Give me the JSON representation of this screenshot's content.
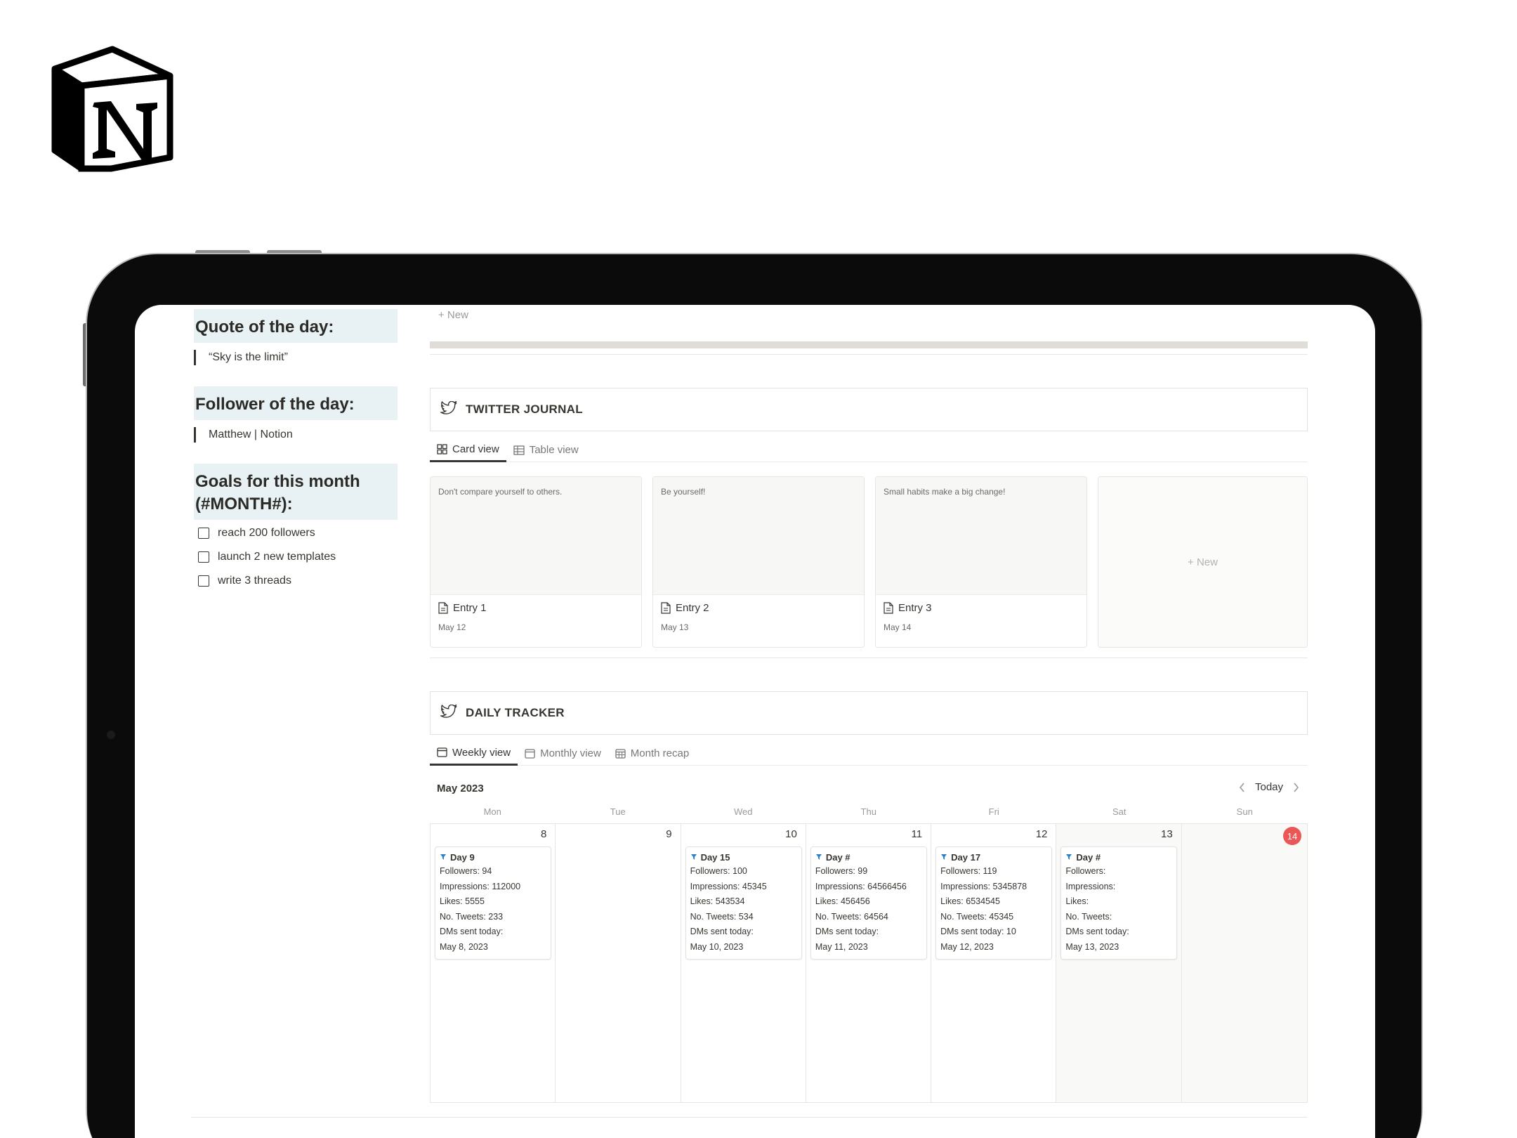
{
  "left": {
    "quote": {
      "heading": "Quote of the day:",
      "text": "“Sky is the limit”"
    },
    "follower": {
      "heading": "Follower of the day:",
      "text": "Matthew | Notion"
    },
    "goals": {
      "heading": "Goals for this month (#MONTH#):",
      "items": [
        "reach 200 followers",
        "launch 2 new templates",
        "write 3 threads"
      ]
    }
  },
  "top_new_label": "+ New",
  "twitter_journal": {
    "title": "TWITTER JOURNAL",
    "tabs": [
      "Card view",
      "Table view"
    ],
    "cards": [
      {
        "preview": "Don't compare yourself to others.",
        "title": "Entry 1",
        "date": "May 12"
      },
      {
        "preview": "Be yourself!",
        "title": "Entry 2",
        "date": "May 13"
      },
      {
        "preview": "Small habits make a big change!",
        "title": "Entry 3",
        "date": "May 14"
      }
    ],
    "new_label": "+ New"
  },
  "daily_tracker": {
    "title": "DAILY TRACKER",
    "tabs": [
      "Weekly view",
      "Monthly view",
      "Month recap"
    ],
    "month": "May 2023",
    "today_label": "Today",
    "weekdays": [
      "Mon",
      "Tue",
      "Wed",
      "Thu",
      "Fri",
      "Sat",
      "Sun"
    ],
    "days": [
      {
        "num": "8",
        "entry": {
          "title": "Day 9",
          "lines": [
            "Followers: 94",
            "Impressions: 112000",
            "Likes: 5555",
            "No. Tweets: 233",
            "DMs sent today:",
            "May 8, 2023"
          ]
        }
      },
      {
        "num": "9"
      },
      {
        "num": "10",
        "entry": {
          "title": "Day 15",
          "lines": [
            "Followers: 100",
            "Impressions: 45345",
            "Likes: 543534",
            "No. Tweets: 534",
            "DMs sent today:",
            "May 10, 2023"
          ]
        }
      },
      {
        "num": "11",
        "entry": {
          "title": "Day #",
          "lines": [
            "Followers: 99",
            "Impressions: 64566456",
            "Likes: 456456",
            "No. Tweets: 64564",
            "DMs sent today:",
            "May 11, 2023"
          ]
        }
      },
      {
        "num": "12",
        "entry": {
          "title": "Day 17",
          "lines": [
            "Followers: 119",
            "Impressions: 5345878",
            "Likes: 6534545",
            "No. Tweets: 45345",
            "DMs sent today: 10",
            "May 12, 2023"
          ]
        }
      },
      {
        "num": "13",
        "entry": {
          "title": "Day #",
          "lines": [
            "Followers:",
            "Impressions:",
            "Likes:",
            "No. Tweets:",
            "DMs sent today:",
            "May 13, 2023"
          ]
        }
      },
      {
        "num": "14",
        "today": true
      }
    ]
  },
  "colors": {
    "today_badge": "#eb5757",
    "callout_bg": "#e8f1f4",
    "pin_icon": "#2f80c8"
  }
}
